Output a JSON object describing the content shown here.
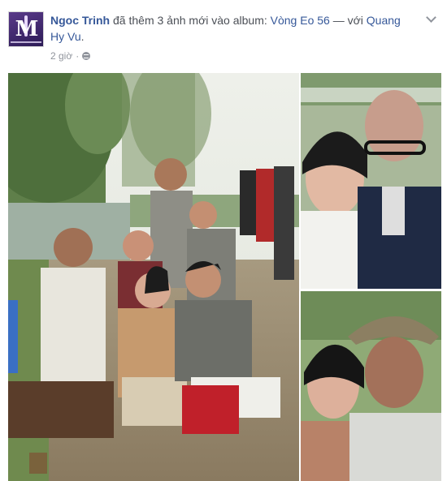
{
  "post": {
    "author": "Ngoc Trinh",
    "action_text": " đã thêm 3 ảnh mới vào album: ",
    "album": "Vòng Eo 56",
    "with_text": " — với ",
    "tagged": "Quang Hy Vu",
    "end": ".",
    "time": "2 giờ",
    "separator": "·",
    "privacy_icon": "globe-icon",
    "options_icon": "chevron-down-icon"
  },
  "photos": [
    {
      "id": "main",
      "subject": "group-photo"
    },
    {
      "id": "top-right",
      "subject": "selfie-two-people"
    },
    {
      "id": "bottom-right",
      "subject": "selfie-woman-and-man-in-hat"
    }
  ]
}
